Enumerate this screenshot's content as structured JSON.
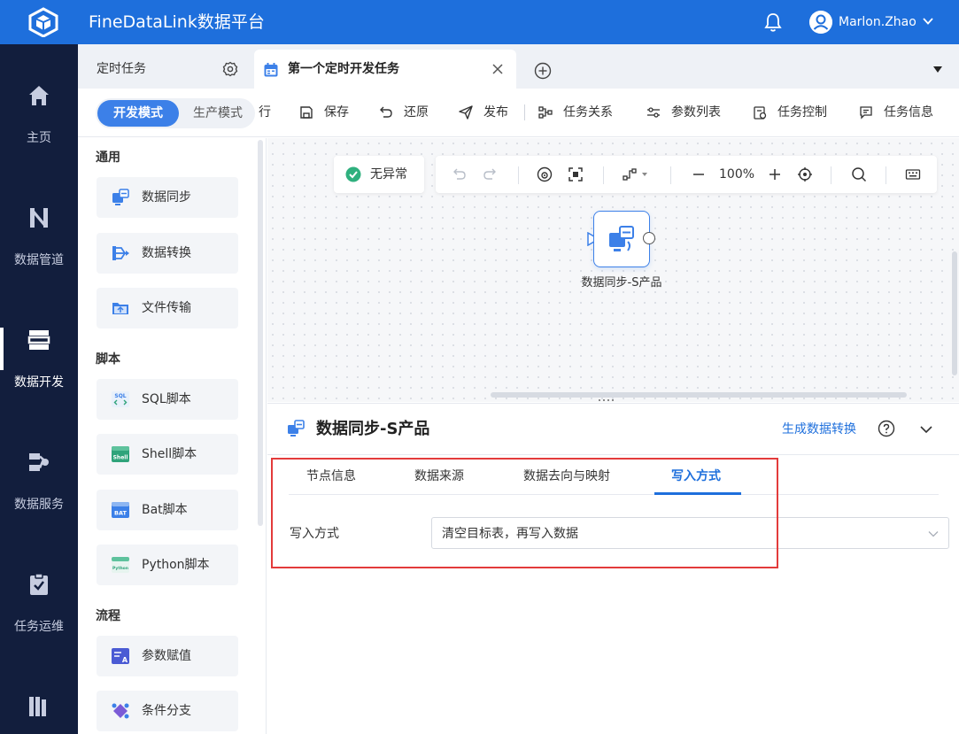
{
  "header": {
    "app_title": "FineDataLink数据平台",
    "user_name": "Marlon.Zhao",
    "brand_color": "#1e6fdc"
  },
  "left_nav": {
    "items": [
      {
        "label": "主页",
        "icon": "home-icon"
      },
      {
        "label": "数据管道",
        "icon": "pipeline-icon"
      },
      {
        "label": "数据开发",
        "icon": "dev-icon",
        "active": true
      },
      {
        "label": "数据服务",
        "icon": "service-icon"
      },
      {
        "label": "任务运维",
        "icon": "ops-icon"
      }
    ]
  },
  "tabs": {
    "scheduled_tasks": "定时任务",
    "active_tab": "第一个定时开发任务"
  },
  "toolbar": {
    "mode_dev": "开发模式",
    "mode_prod": "生产模式",
    "cut_text": "行",
    "save": "保存",
    "restore": "还原",
    "publish": "发布",
    "task_relations": "任务关系",
    "param_list": "参数列表",
    "task_control": "任务控制",
    "task_info": "任务信息"
  },
  "components": {
    "section_general": "通用",
    "general": [
      "数据同步",
      "数据转换",
      "文件传输"
    ],
    "section_script": "脚本",
    "scripts": [
      "SQL脚本",
      "Shell脚本",
      "Bat脚本",
      "Python脚本"
    ],
    "section_flow": "流程",
    "flow": [
      "参数赋值",
      "条件分支"
    ]
  },
  "canvas": {
    "status": "无异常",
    "zoom": "100%",
    "node_label": "数据同步-S产品"
  },
  "detail": {
    "title": "数据同步-S产品",
    "generate_link": "生成数据转换",
    "tabs": [
      "节点信息",
      "数据来源",
      "数据去向与映射",
      "写入方式"
    ],
    "active_tab_index": 3,
    "write_mode_label": "写入方式",
    "write_mode_value": "清空目标表，再写入数据",
    "highlight_color": "#e33b3b"
  }
}
